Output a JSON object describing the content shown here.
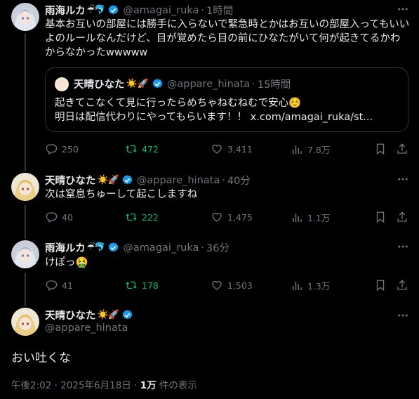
{
  "tweet1": {
    "name": "雨海ルカ",
    "emoji": "☔🐬",
    "handle": "@amagai_ruka",
    "dot": "·",
    "time": "1時間",
    "text": "基本お互いの部屋には勝手に入らないで緊急時とかはお互いの部屋入ってもいいよのルールなんだけど、目が覚めたら目の前にひなたがいて何が起きてるかわからなかったwwwww",
    "quote": {
      "name": "天晴ひなた",
      "emoji": "☀️🚀",
      "handle": "@appare_hinata",
      "dot": "·",
      "time": "15時間",
      "line1": "起きてこなくて見に行ったらめちゃねむねむで安心☺️",
      "line2": "明日は配信代わりにやってもらいます！！ x.com/amagai_ruka/st..."
    },
    "replies": "250",
    "retweets": "472",
    "likes": "3,411",
    "views": "7.8万"
  },
  "tweet2": {
    "name": "天晴ひなた",
    "emoji": "☀️🚀",
    "handle": "@appare_hinata",
    "dot": "·",
    "time": "40分",
    "text": "次は窒息ちゅーして起こしますね",
    "replies": "40",
    "retweets": "222",
    "likes": "1,475",
    "views": "1.1万"
  },
  "tweet3": {
    "name": "雨海ルカ",
    "emoji": "☔🐬",
    "handle": "@amagai_ruka",
    "dot": "·",
    "time": "36分",
    "text": "けぽっ🤮",
    "replies": "41",
    "retweets": "178",
    "likes": "1,503",
    "views": "1.3万"
  },
  "main": {
    "name": "天晴ひなた",
    "emoji": "☀️🚀",
    "handle": "@appare_hinata",
    "text": "おい吐くな",
    "time": "午後2:02 · 2025年6月18日 · ",
    "views_count": "1万",
    "views_suffix": " 件の表示"
  },
  "colors": {
    "background": "#000000",
    "verified": "#1d9bf0",
    "retweet": "#00ba7c",
    "muted": "#71767b"
  }
}
